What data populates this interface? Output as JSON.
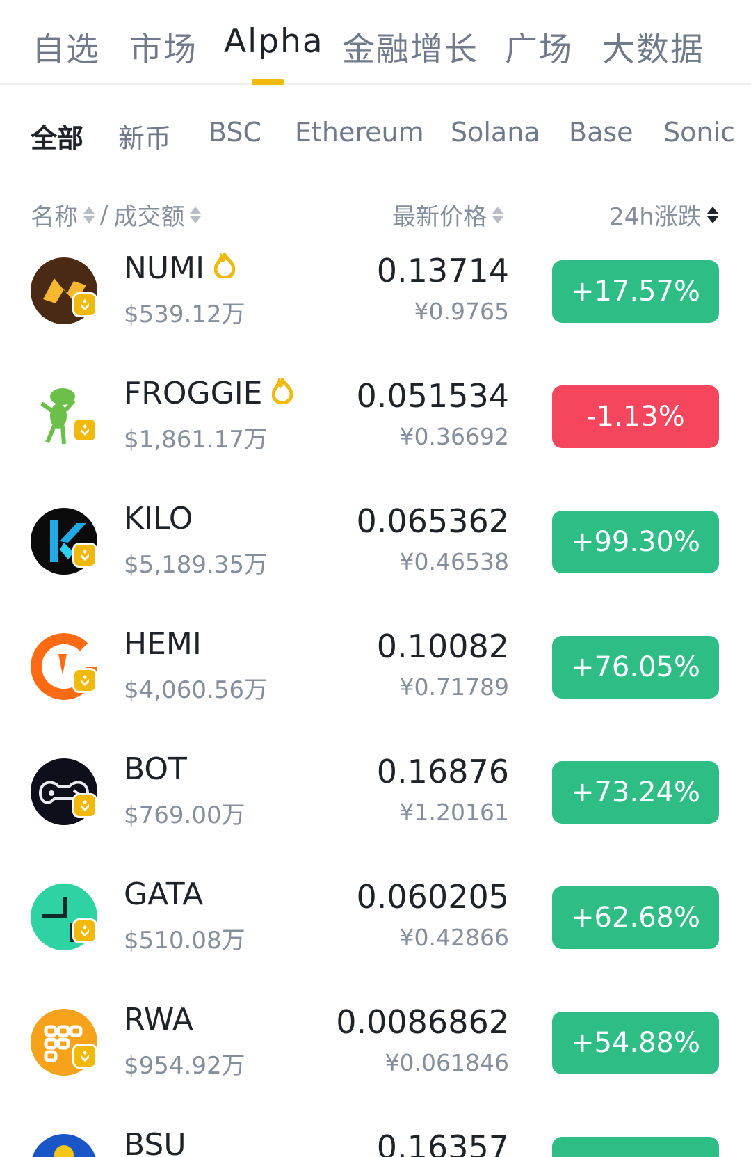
{
  "top_tabs": [
    {
      "label": "自选"
    },
    {
      "label": "市场"
    },
    {
      "label": "Alpha"
    },
    {
      "label": "金融增长"
    },
    {
      "label": "广场"
    },
    {
      "label": "大数据"
    }
  ],
  "sub_tabs": [
    {
      "label": "全部"
    },
    {
      "label": "新币"
    },
    {
      "label": "BSC"
    },
    {
      "label": "Ethereum"
    },
    {
      "label": "Solana"
    },
    {
      "label": "Base"
    },
    {
      "label": "Sonic"
    }
  ],
  "header": {
    "name": "名称",
    "separator": "/",
    "volume": "成交额",
    "price": "最新价格",
    "change": "24h涨跌"
  },
  "rows": [
    {
      "symbol": "NUMI",
      "volume": "$539.12万",
      "price": "0.13714",
      "cny": "¥0.9765",
      "change": "+17.57%",
      "hot": true,
      "direction": "up"
    },
    {
      "symbol": "FROGGIE",
      "volume": "$1,861.17万",
      "price": "0.051534",
      "cny": "¥0.36692",
      "change": "-1.13%",
      "hot": true,
      "direction": "down"
    },
    {
      "symbol": "KILO",
      "volume": "$5,189.35万",
      "price": "0.065362",
      "cny": "¥0.46538",
      "change": "+99.30%",
      "hot": false,
      "direction": "up"
    },
    {
      "symbol": "HEMI",
      "volume": "$4,060.56万",
      "price": "0.10082",
      "cny": "¥0.71789",
      "change": "+76.05%",
      "hot": false,
      "direction": "up"
    },
    {
      "symbol": "BOT",
      "volume": "$769.00万",
      "price": "0.16876",
      "cny": "¥1.20161",
      "change": "+73.24%",
      "hot": false,
      "direction": "up"
    },
    {
      "symbol": "GATA",
      "volume": "$510.08万",
      "price": "0.060205",
      "cny": "¥0.42866",
      "change": "+62.68%",
      "hot": false,
      "direction": "up"
    },
    {
      "symbol": "RWA",
      "volume": "$954.92万",
      "price": "0.0086862",
      "cny": "¥0.061846",
      "change": "+54.88%",
      "hot": false,
      "direction": "up"
    },
    {
      "symbol": "BSU",
      "volume": "",
      "price": "0.16357",
      "cny": "",
      "change": "",
      "hot": false,
      "direction": "up"
    }
  ],
  "colors": {
    "accent": "#f0b90b",
    "up": "#2ebd85",
    "down": "#f6465d"
  }
}
